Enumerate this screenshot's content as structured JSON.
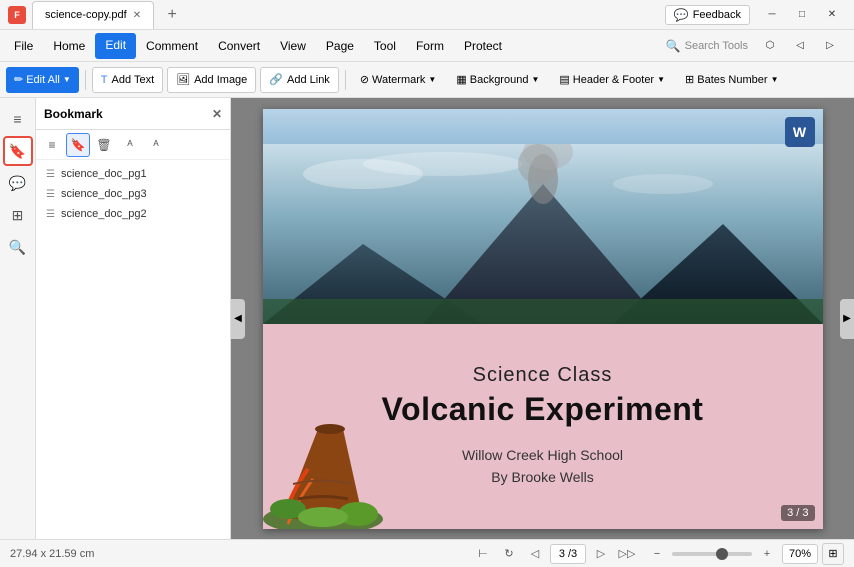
{
  "titlebar": {
    "app_icon_label": "F",
    "tab_label": "science-copy.pdf",
    "new_tab_label": "+",
    "feedback_label": "Feedback",
    "minimize_label": "─",
    "maximize_label": "□",
    "close_label": "✕"
  },
  "menubar": {
    "items": [
      {
        "id": "file",
        "label": "File"
      },
      {
        "id": "home",
        "label": "Home"
      },
      {
        "id": "edit",
        "label": "Edit",
        "active": true
      },
      {
        "id": "comment",
        "label": "Comment"
      },
      {
        "id": "convert",
        "label": "Convert"
      },
      {
        "id": "view",
        "label": "View"
      },
      {
        "id": "page",
        "label": "Page"
      },
      {
        "id": "tool",
        "label": "Tool"
      },
      {
        "id": "form",
        "label": "Form"
      },
      {
        "id": "protect",
        "label": "Protect"
      }
    ],
    "search_placeholder": "Search Tools"
  },
  "toolbar": {
    "edit_all_label": "Edit All",
    "add_text_label": "Add Text",
    "add_image_label": "Add Image",
    "add_link_label": "Add Link",
    "watermark_label": "Watermark",
    "background_label": "Background",
    "header_footer_label": "Header & Footer",
    "bates_number_label": "Bates Number"
  },
  "bookmark_panel": {
    "title": "Bookmark",
    "items": [
      {
        "label": "science_doc_pg1"
      },
      {
        "label": "science_doc_pg3"
      },
      {
        "label": "science_doc_pg2"
      }
    ]
  },
  "sidebar_icons": [
    {
      "id": "hamburger",
      "icon": "≡",
      "active": false
    },
    {
      "id": "bookmark",
      "icon": "🔖",
      "active": true
    },
    {
      "id": "comment",
      "icon": "💬",
      "active": false
    },
    {
      "id": "pages",
      "icon": "⊞",
      "active": false
    },
    {
      "id": "search",
      "icon": "🔍",
      "active": false
    }
  ],
  "pdf_content": {
    "title_small": "Science Class",
    "title_large": "Volcanic Experiment",
    "subtitle_line1": "Willow Creek High School",
    "subtitle_line2": "By Brooke Wells",
    "page_badge": "3 / 3",
    "word_badge": "W"
  },
  "statusbar": {
    "dimensions": "27.94 x 21.59 cm",
    "page_display": "3 /3",
    "zoom_level": "70%"
  }
}
